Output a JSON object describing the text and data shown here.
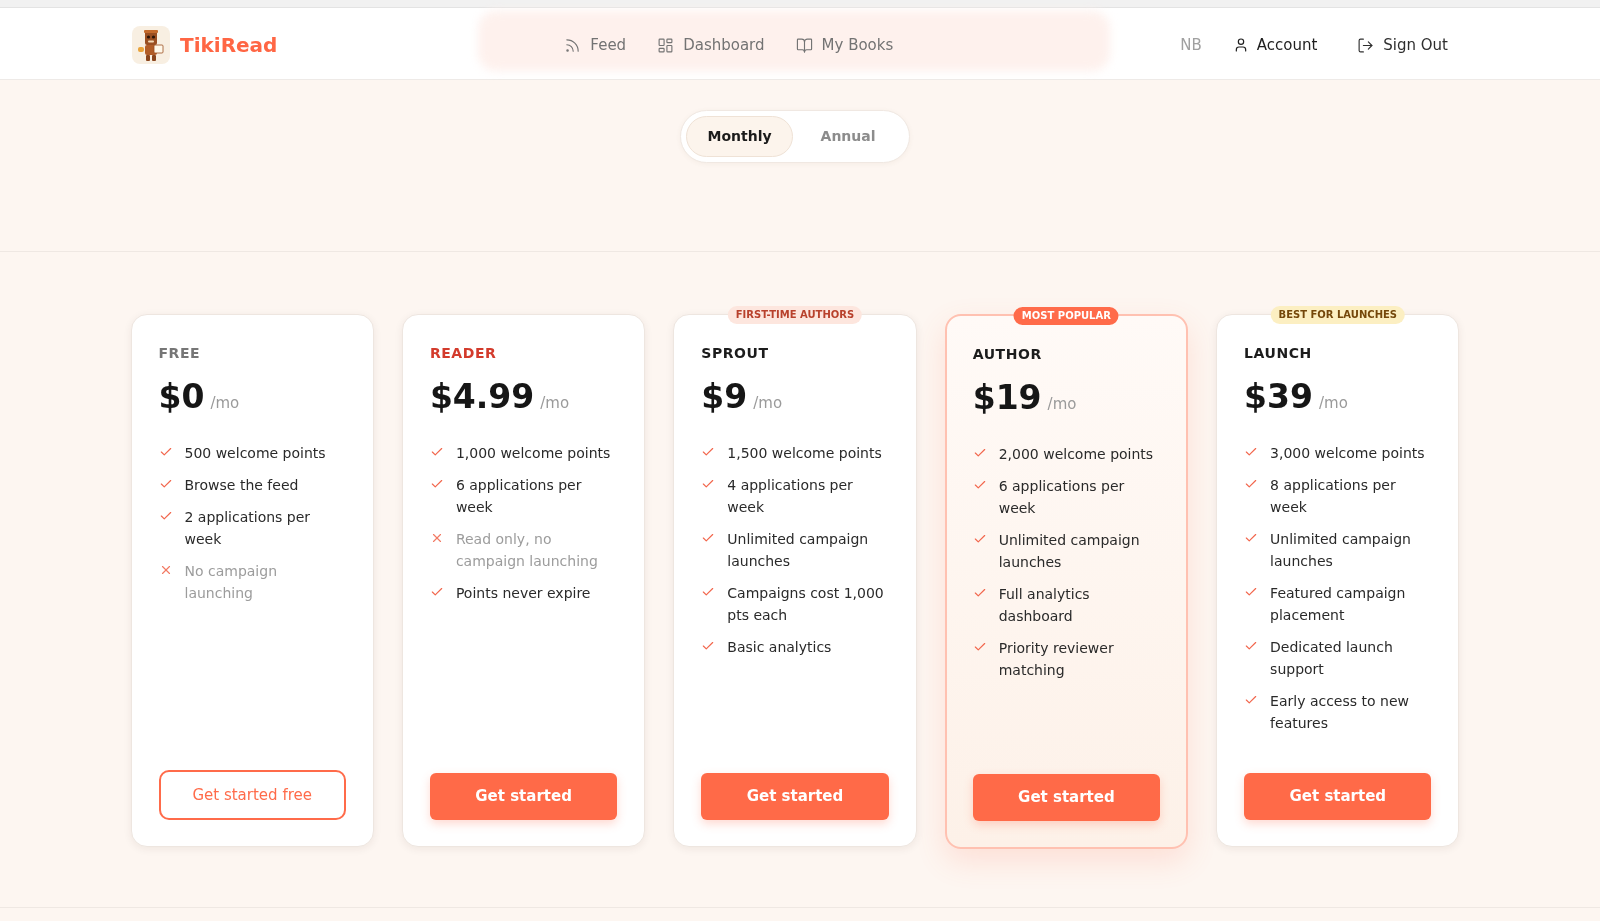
{
  "brand": {
    "name": "TikiRead"
  },
  "nav": [
    {
      "label": "Feed"
    },
    {
      "label": "Dashboard"
    },
    {
      "label": "My Books"
    }
  ],
  "user": {
    "initials": "NB",
    "account": "Account",
    "sign_out": "Sign Out"
  },
  "billing_toggle": [
    {
      "label": "Monthly",
      "selected": true
    },
    {
      "label": "Annual",
      "selected": false
    }
  ],
  "plans": [
    {
      "name": "FREE",
      "color": "#767676",
      "price": "$0",
      "period": "/mo",
      "highlighted": false,
      "features": [
        {
          "text": "500 welcome points",
          "included": true
        },
        {
          "text": "Browse the feed",
          "included": true
        },
        {
          "text": "2 applications per week",
          "included": true
        },
        {
          "text": "No campaign launching",
          "included": false
        }
      ],
      "button": {
        "label": "Get started free",
        "kind": "outline"
      }
    },
    {
      "name": "READER",
      "color": "#d33b2c",
      "price": "$4.99",
      "period": "/mo",
      "highlighted": false,
      "features": [
        {
          "text": "1,000 welcome points",
          "included": true
        },
        {
          "text": "6 applications per week",
          "included": true
        },
        {
          "text": "Read only, no campaign launching",
          "included": false
        },
        {
          "text": "Points never expire",
          "included": true
        }
      ],
      "button": {
        "label": "Get started",
        "kind": "solid"
      }
    },
    {
      "name": "SPROUT",
      "color": "#1c1c1c",
      "price": "$9",
      "period": "/mo",
      "highlighted": false,
      "badge": {
        "text": "FIRST-TIME AUTHORS",
        "kind": "soft"
      },
      "features": [
        {
          "text": "1,500 welcome points",
          "included": true
        },
        {
          "text": "4 applications per week",
          "included": true
        },
        {
          "text": "Unlimited campaign launches",
          "included": true
        },
        {
          "text": "Campaigns cost 1,000 pts each",
          "included": true
        },
        {
          "text": "Basic analytics",
          "included": true
        }
      ],
      "button": {
        "label": "Get started",
        "kind": "solid"
      }
    },
    {
      "name": "AUTHOR",
      "color": "#1c1c1c",
      "price": "$19",
      "period": "/mo",
      "highlighted": true,
      "badge": {
        "text": "MOST POPULAR",
        "kind": "solid"
      },
      "features": [
        {
          "text": "2,000 welcome points",
          "included": true
        },
        {
          "text": "6 applications per week",
          "included": true
        },
        {
          "text": "Unlimited campaign launches",
          "included": true
        },
        {
          "text": "Full analytics dashboard",
          "included": true
        },
        {
          "text": "Priority reviewer matching",
          "included": true
        }
      ],
      "button": {
        "label": "Get started",
        "kind": "solid"
      }
    },
    {
      "name": "LAUNCH",
      "color": "#1c1c1c",
      "price": "$39",
      "period": "/mo",
      "highlighted": false,
      "badge": {
        "text": "BEST FOR LAUNCHES",
        "kind": "amber"
      },
      "features": [
        {
          "text": "3,000 welcome points",
          "included": true
        },
        {
          "text": "8 applications per week",
          "included": true
        },
        {
          "text": "Unlimited campaign launches",
          "included": true
        },
        {
          "text": "Featured campaign placement",
          "included": true
        },
        {
          "text": "Dedicated launch support",
          "included": true
        },
        {
          "text": "Early access to new features",
          "included": true
        }
      ],
      "button": {
        "label": "Get started",
        "kind": "solid"
      }
    }
  ]
}
